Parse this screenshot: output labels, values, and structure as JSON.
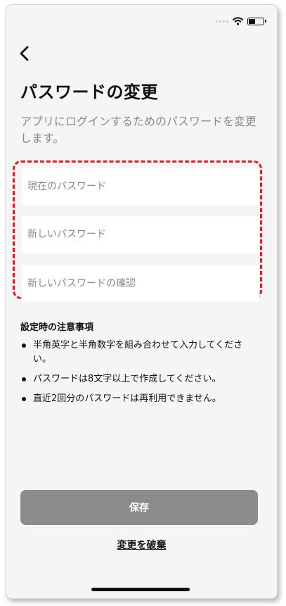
{
  "header": {
    "back_icon": "chevron-left-icon",
    "title": "パスワードの変更"
  },
  "description": "アプリにログインするためのパスワードを変更します。",
  "form": {
    "current_password_placeholder": "現在のパスワード",
    "new_password_placeholder": "新しいパスワード",
    "confirm_password_placeholder": "新しいパスワードの確認",
    "highlight_color": "#d0202a"
  },
  "notes": {
    "title": "設定時の注意事項",
    "items": [
      "半角英字と半角数字を組み合わせて入力してください。",
      "パスワードは8文字以上で作成してください。",
      "直近2回分のパスワードは再利用できません。"
    ]
  },
  "actions": {
    "save_label": "保存",
    "discard_label": "変更を破棄",
    "save_color": "#8c8c8c"
  },
  "status_bar": {
    "icons": [
      "signal-icon",
      "wifi-icon",
      "battery-icon"
    ]
  }
}
